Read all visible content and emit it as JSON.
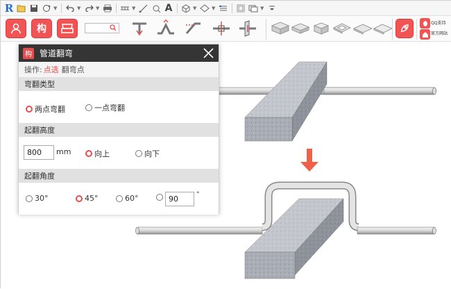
{
  "quick_access": {
    "app_logo": "R",
    "icons": [
      "open-icon",
      "save-icon",
      "sync-icon",
      "undo-icon",
      "redo-icon",
      "print-icon",
      "measure-icon",
      "dimension-icon",
      "tag-icon",
      "text-icon",
      "3d-view-icon",
      "section-icon",
      "thin-lines-icon",
      "close-hidden-icon",
      "switch-windows-icon",
      "customize-icon"
    ],
    "text_tool_label": "A"
  },
  "ribbon": {
    "search_placeholder": "",
    "brand": {
      "qq_label": "QQ支持",
      "site_label": "官方网站"
    }
  },
  "dialog": {
    "title": "管道翻弯",
    "icon_label": "构",
    "operation": {
      "prefix": "操作:",
      "pick_label": "点选",
      "bend_point_label": "翻弯点"
    },
    "bend_type": {
      "heading": "弯翻类型",
      "options": [
        {
          "label": "两点弯翻",
          "selected": true
        },
        {
          "label": "一点弯翻",
          "selected": false
        }
      ]
    },
    "bend_height": {
      "heading": "起翻高度",
      "value": "800",
      "unit": "mm",
      "options": [
        {
          "label": "向上",
          "selected": true
        },
        {
          "label": "向下",
          "selected": false
        }
      ]
    },
    "bend_angle": {
      "heading": "起翻角度",
      "options": [
        {
          "label": "30°",
          "selected": false
        },
        {
          "label": "45°",
          "selected": true
        },
        {
          "label": "60°",
          "selected": false
        }
      ],
      "custom_value": "90",
      "custom_unit": "°"
    }
  },
  "colors": {
    "accent": "#e84d4d",
    "title_bar": "#353535",
    "section_header": "#e1e1e1",
    "arrow": "#f0614b"
  }
}
